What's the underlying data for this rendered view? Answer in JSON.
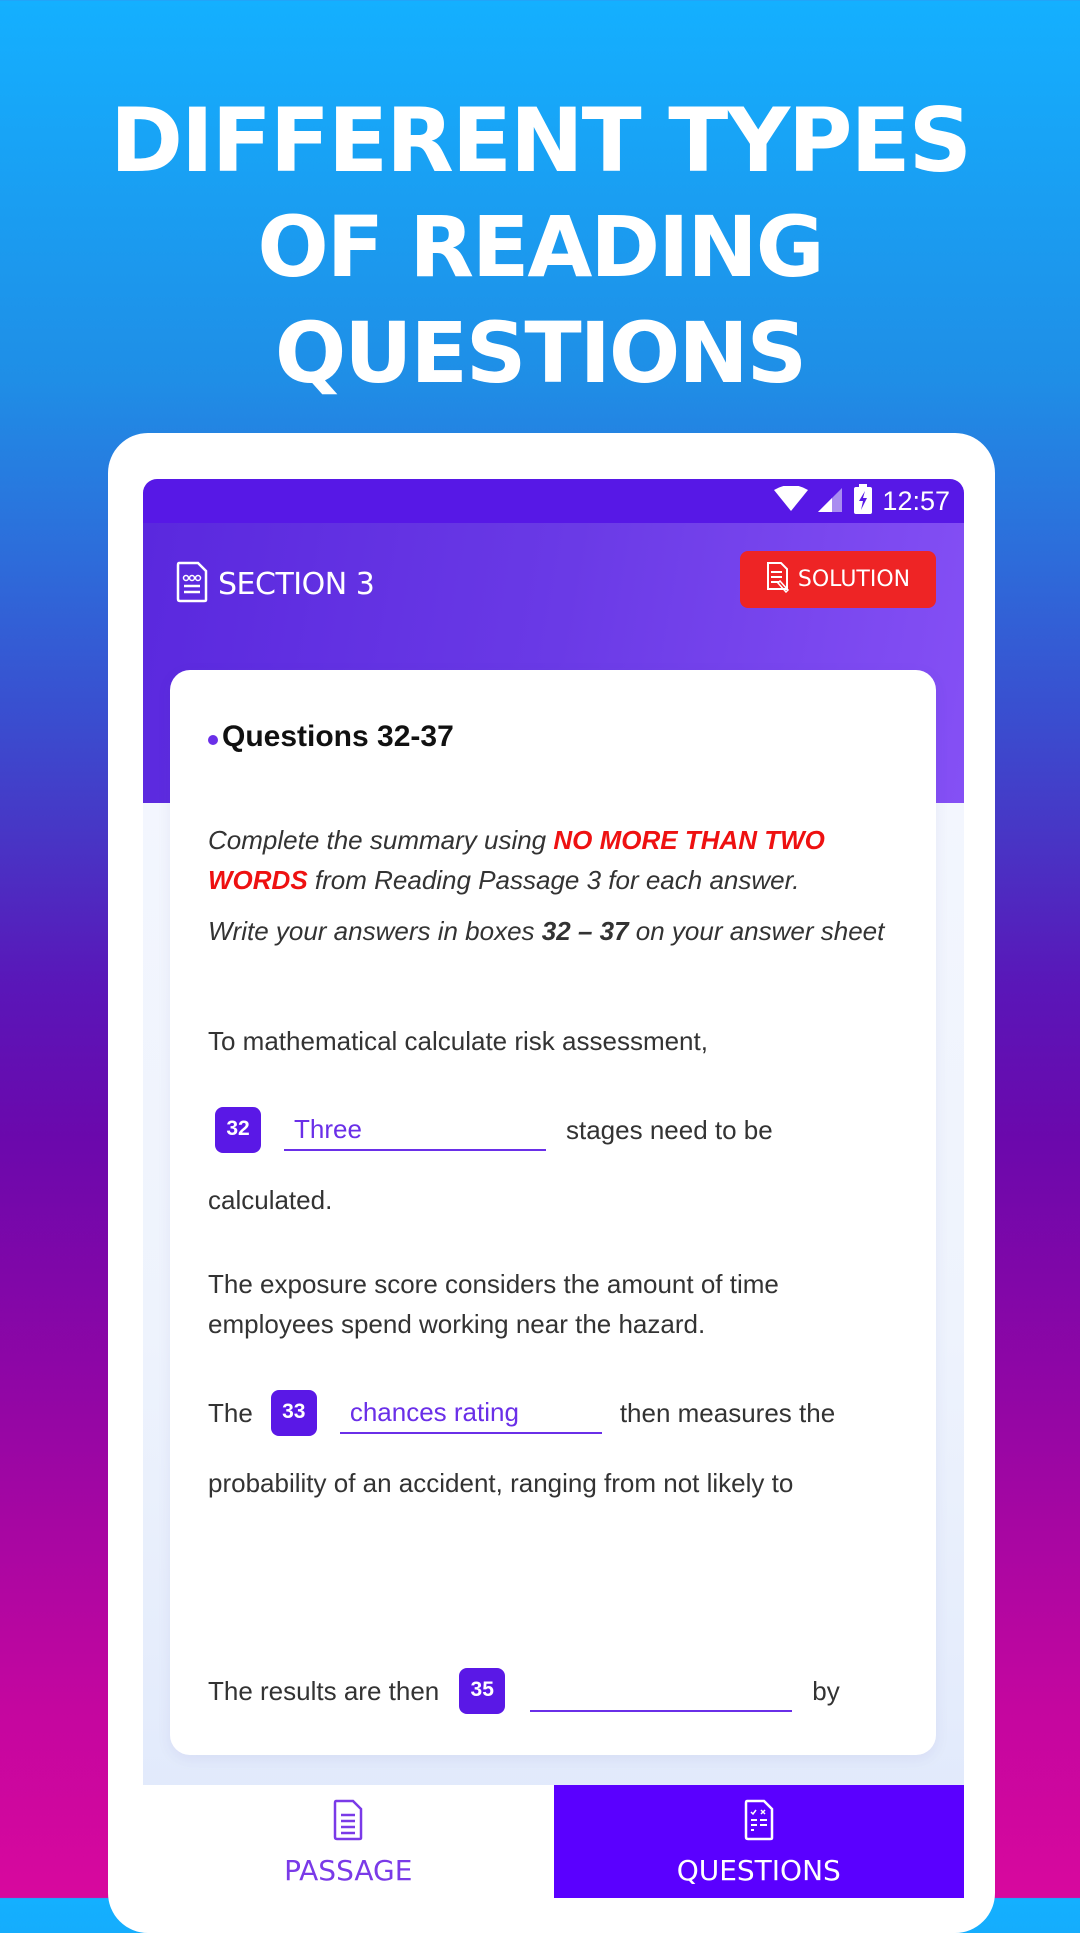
{
  "promo": {
    "line1": "DIFFERENT TYPES",
    "line2": "OF READING QUESTIONS"
  },
  "status_bar": {
    "time": "12:57",
    "icons": [
      "wifi-icon",
      "cellular-signal-icon",
      "battery-charging-icon"
    ]
  },
  "app_bar": {
    "icon": "document-icon",
    "title": "SECTION 3",
    "solution_button": {
      "icon": "solution-document-icon",
      "label": "SOLUTION"
    }
  },
  "questions": {
    "heading": "Questions 32-37",
    "instruction1": {
      "before": "Complete the summary using ",
      "emphasis": "NO MORE THAN TWO WORDS",
      "after": " from Reading Passage 3 for each answer."
    },
    "instruction2": {
      "before": "Write your answers in boxes ",
      "bold": "32 – 37",
      "after": " on your answer sheet"
    },
    "intro": "To mathematical calculate risk assessment,",
    "items": [
      {
        "number": "32",
        "before": "",
        "answer": "Three",
        "after": "stages need to be",
        "continuation": "calculated."
      },
      {
        "number": "33",
        "before": "The",
        "answer": "chances rating",
        "after": "then measures the",
        "continuation": "probability of an accident, ranging from not likely to"
      },
      {
        "number": "35",
        "before": "The results are then",
        "answer": "",
        "after": "by",
        "continuation": ""
      }
    ],
    "exposure_text": "The exposure score considers the amount of time employees spend working near the hazard."
  },
  "tabs": [
    {
      "icon": "passage-document-icon",
      "label": "PASSAGE",
      "active": false
    },
    {
      "icon": "questions-checklist-icon",
      "label": "QUESTIONS",
      "active": true
    }
  ],
  "colors": {
    "accent": "#5a18e6",
    "solution_red": "#ee2425",
    "emphasis_red": "#ee1111",
    "active_tab": "#5a00ff"
  }
}
